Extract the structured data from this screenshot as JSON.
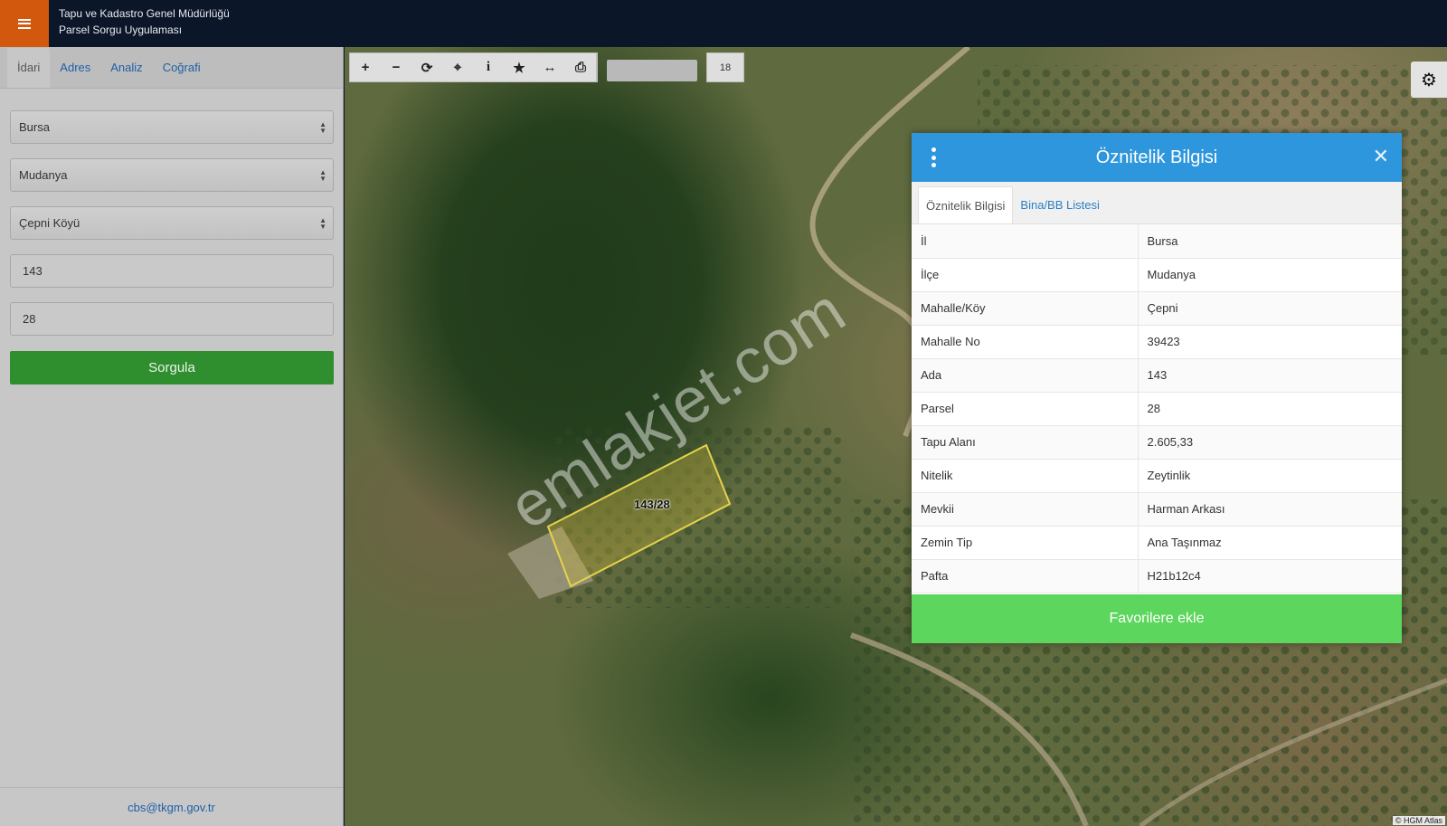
{
  "header": {
    "menu_icon": "hamburger-icon",
    "title_line1": "Tapu ve Kadastro Genel Müdürlüğü",
    "title_line2": "Parsel Sorgu Uygulaması",
    "menu_color": "#d2580e"
  },
  "sidebar": {
    "tabs": [
      {
        "label": "İdari",
        "active": true
      },
      {
        "label": "Adres",
        "active": false
      },
      {
        "label": "Analiz",
        "active": false
      },
      {
        "label": "Coğrafi",
        "active": false
      }
    ],
    "province": "Bursa",
    "district": "Mudanya",
    "neighborhood": "Çepni Köyü",
    "block": "143",
    "parcel": "28",
    "query_label": "Sorgula",
    "footer_email": "cbs@tkgm.gov.tr"
  },
  "toolbar": {
    "tools": [
      "zoom-in-icon",
      "zoom-out-icon",
      "refresh-icon",
      "locate-icon",
      "info-icon",
      "star-icon",
      "measure-icon",
      "print-icon"
    ],
    "zoom_level": "18"
  },
  "map": {
    "parcel_label": "143/28",
    "watermark": "emlakjet.com",
    "attribution": "© HGM Atlas"
  },
  "popup": {
    "title": "Öznitelik Bilgisi",
    "tabs": [
      {
        "label": "Öznitelik Bilgisi",
        "active": true
      },
      {
        "label": "Bina/BB Listesi",
        "active": false
      }
    ],
    "rows": [
      {
        "key": "İl",
        "value": "Bursa"
      },
      {
        "key": "İlçe",
        "value": "Mudanya"
      },
      {
        "key": "Mahalle/Köy",
        "value": "Çepni"
      },
      {
        "key": "Mahalle No",
        "value": "39423"
      },
      {
        "key": "Ada",
        "value": "143"
      },
      {
        "key": "Parsel",
        "value": "28"
      },
      {
        "key": "Tapu Alanı",
        "value": "2.605,33"
      },
      {
        "key": "Nitelik",
        "value": "Zeytinlik"
      },
      {
        "key": "Mevkii",
        "value": "Harman Arkası"
      },
      {
        "key": "Zemin Tip",
        "value": "Ana Taşınmaz"
      },
      {
        "key": "Pafta",
        "value": "H21b12c4"
      }
    ],
    "favorite_label": "Favorilere ekle",
    "header_color": "#2e96dc",
    "button_color": "#5cd65c"
  }
}
